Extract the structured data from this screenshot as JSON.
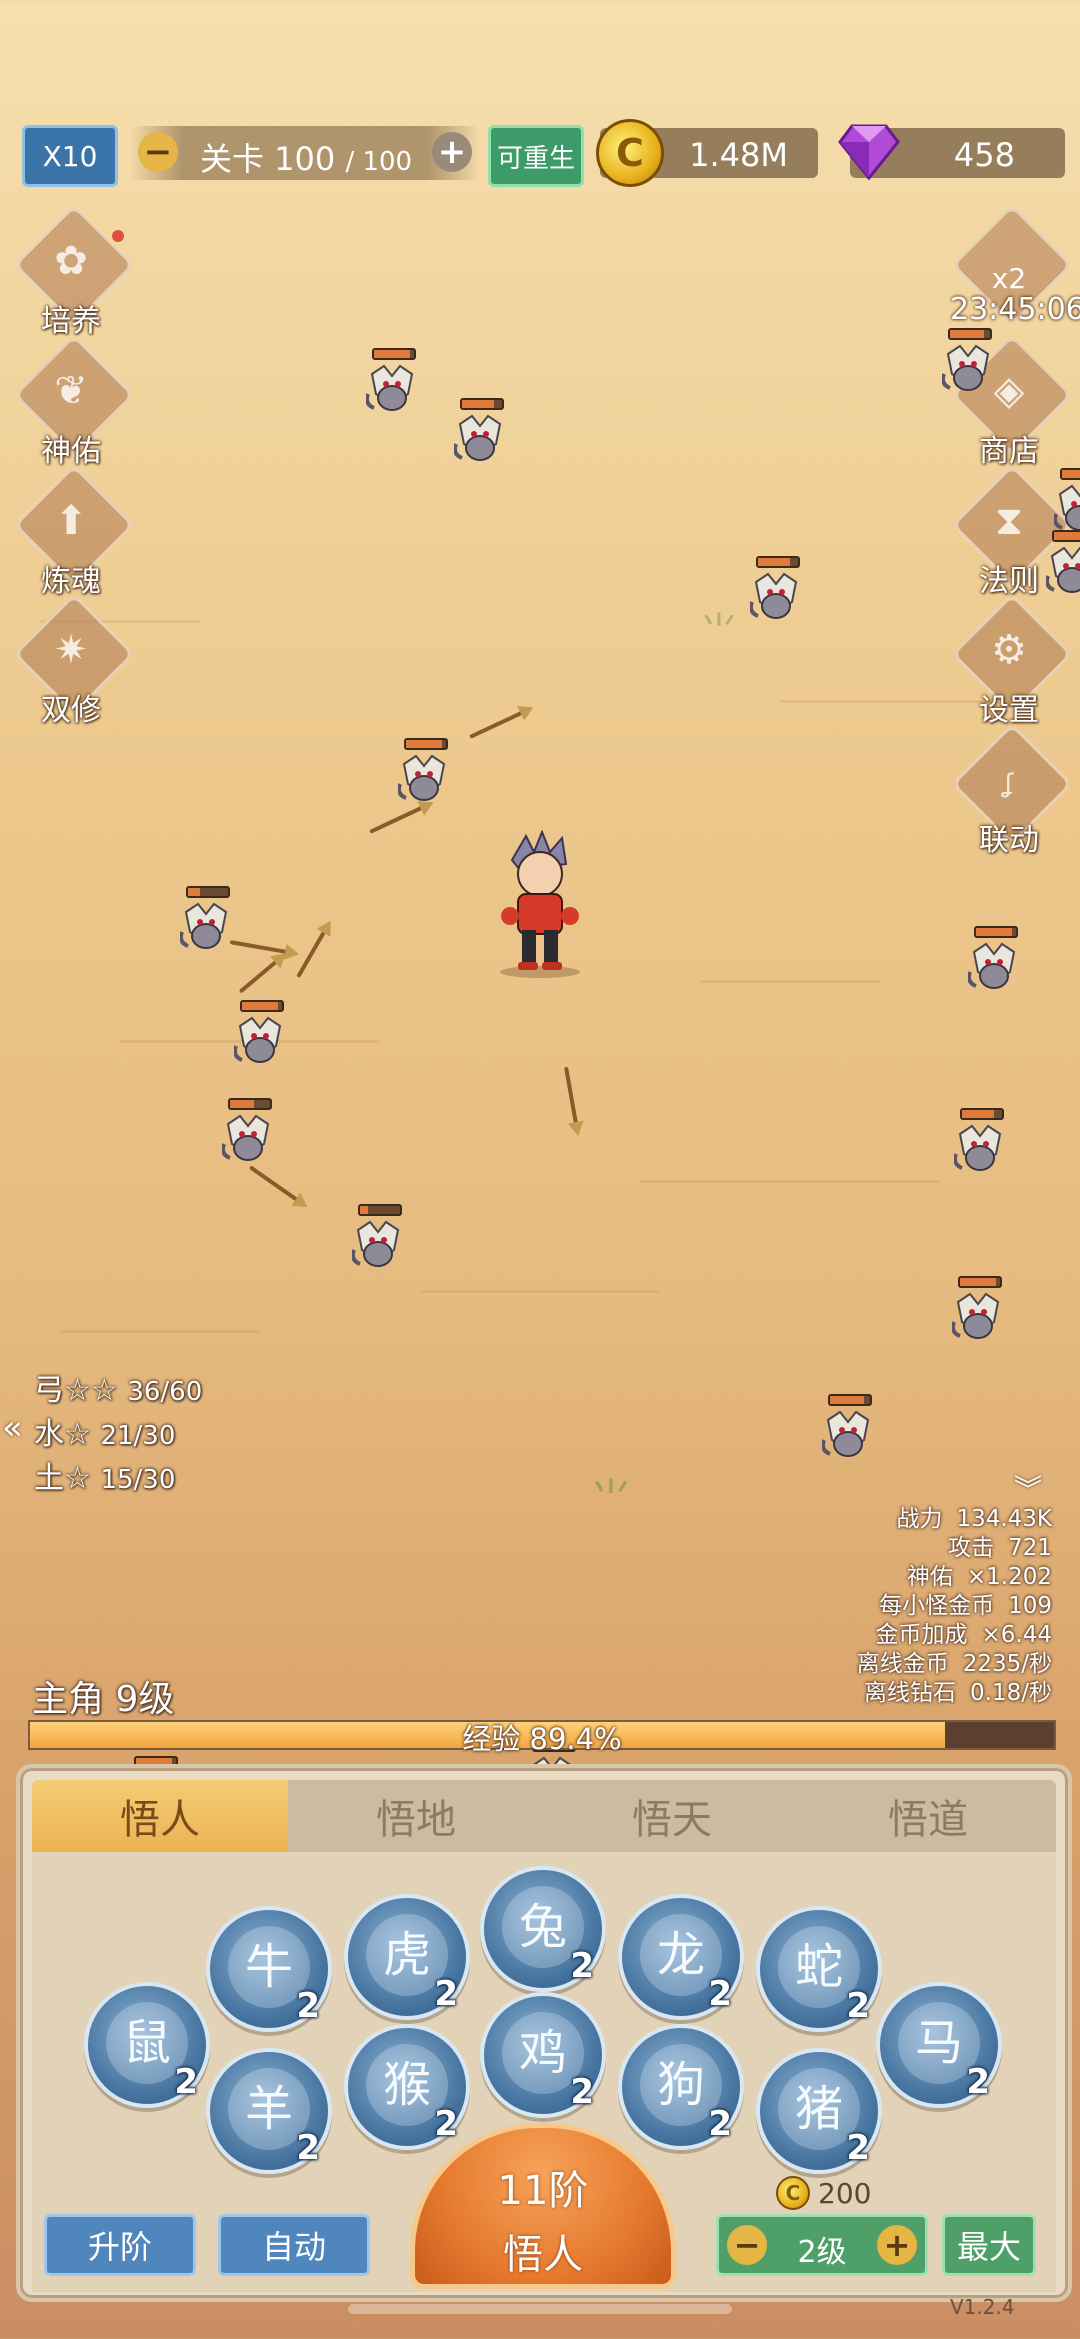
{
  "top": {
    "speed_label": "X10",
    "stage_label": "关卡",
    "stage_current": "100",
    "stage_max": "/ 100",
    "rebirth_label": "可重生",
    "gold": "1.48M",
    "gems": "458"
  },
  "left_menu": [
    "培养",
    "神佑",
    "炼魂",
    "双修"
  ],
  "right_menu": {
    "boost": "x2",
    "timer": "23:45:06",
    "items": [
      "商店",
      "法则",
      "设置",
      "联动"
    ]
  },
  "quests": [
    {
      "label": "弓☆☆ ",
      "progress": "36/60"
    },
    {
      "label": "水☆ ",
      "progress": "21/30"
    },
    {
      "label": "土☆ ",
      "progress": "15/30"
    }
  ],
  "stats": [
    {
      "k": "战力",
      "v": "134.43K"
    },
    {
      "k": "攻击",
      "v": "721"
    },
    {
      "k": "神佑",
      "v": "×1.202"
    },
    {
      "k": "每小怪金币",
      "v": "109"
    },
    {
      "k": "金币加成",
      "v": "×6.44"
    },
    {
      "k": "离线金币",
      "v": "2235/秒"
    },
    {
      "k": "离线钻石",
      "v": "0.18/秒"
    }
  ],
  "hero": {
    "level_label": "主角 9级",
    "exp_label": "经验 89.4%",
    "exp_fraction": 0.894
  },
  "panel": {
    "tabs": [
      "悟人",
      "悟地",
      "悟天",
      "悟道"
    ],
    "zodiac_levels": [
      "2",
      "2",
      "2",
      "2",
      "2",
      "2",
      "2",
      "2",
      "2",
      "2",
      "2",
      "2"
    ],
    "upgrade_label": "升阶",
    "auto_label": "自动",
    "tier_line1": "11阶",
    "tier_line2": "悟人",
    "cost": "200",
    "step_value": "2级",
    "max_label": "最大"
  },
  "version": "V1.2.4",
  "colors": {
    "accent_orange": "#eab254",
    "button_blue": "#4f86bd",
    "button_green": "#4fa068"
  }
}
